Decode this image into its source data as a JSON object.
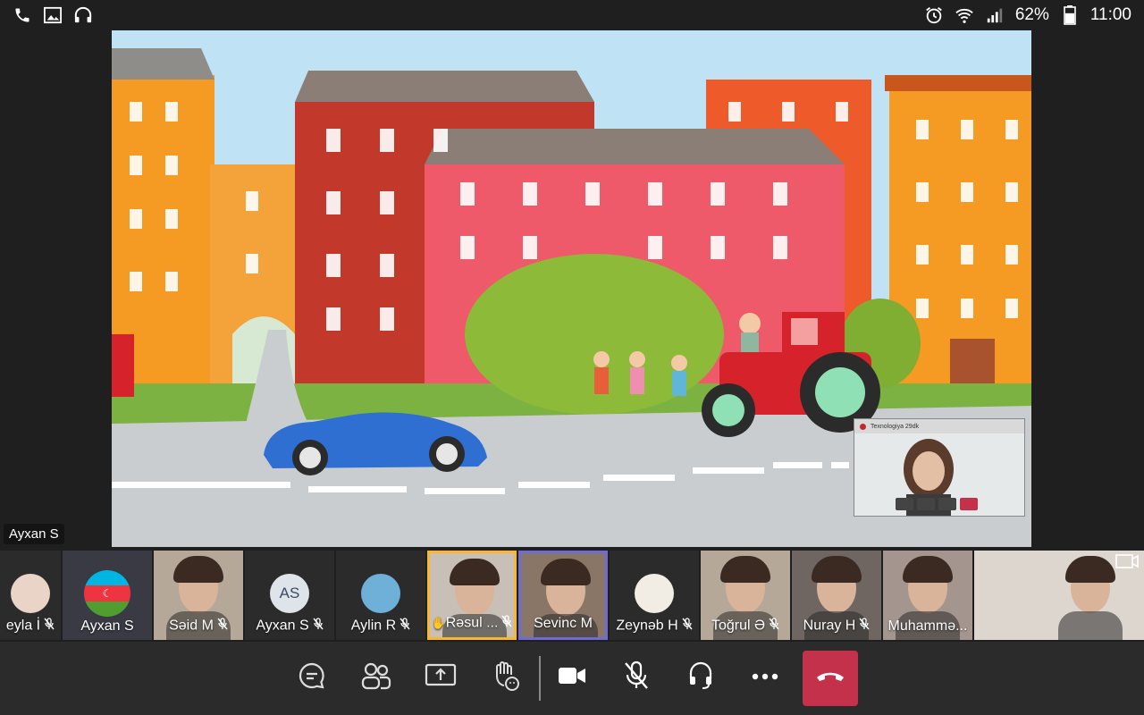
{
  "status_bar": {
    "left_icons": [
      "phone-icon",
      "image-icon",
      "headphones-icon"
    ],
    "right_icons": [
      "alarm-icon",
      "wifi-icon",
      "signal-icon"
    ],
    "battery_percent": "62%",
    "battery_level": 0.62,
    "time": "11:00"
  },
  "shared_screen": {
    "speaker_label": "Ayxan S",
    "pip": {
      "title": "Texnologiya   29dk"
    }
  },
  "participants": [
    {
      "name": "eyla İ",
      "muted": true,
      "kind": "avatar-photo",
      "highlight": ""
    },
    {
      "name": "Ayxan S",
      "muted": false,
      "kind": "flag",
      "highlight": ""
    },
    {
      "name": "Səid M",
      "muted": true,
      "kind": "video",
      "highlight": ""
    },
    {
      "name": "Ayxan S",
      "muted": true,
      "kind": "initials",
      "initials": "AS",
      "highlight": ""
    },
    {
      "name": "Aylin R",
      "muted": true,
      "kind": "avatar-photo",
      "highlight": ""
    },
    {
      "name": "Rəsul ...",
      "muted": true,
      "kind": "video",
      "highlight": "yellow",
      "hand_raised": true
    },
    {
      "name": "Sevinc M",
      "muted": false,
      "kind": "video",
      "highlight": "purple"
    },
    {
      "name": "Zeynəb H",
      "muted": true,
      "kind": "avatar-photo",
      "highlight": ""
    },
    {
      "name": "Toğrul Ə",
      "muted": true,
      "kind": "video",
      "highlight": ""
    },
    {
      "name": "Nuray H",
      "muted": true,
      "kind": "video",
      "highlight": ""
    },
    {
      "name": "Muhammə...",
      "muted": false,
      "kind": "video",
      "highlight": ""
    },
    {
      "name": "",
      "muted": false,
      "kind": "self-video",
      "highlight": ""
    }
  ],
  "controls": {
    "buttons": [
      "chat-icon",
      "participants-icon",
      "share-screen-icon",
      "raise-hand-icon",
      "camera-icon",
      "mic-off-icon",
      "audio-device-icon",
      "more-icon",
      "hang-up-icon"
    ]
  },
  "colors": {
    "end_call": "#c4314b",
    "highlight_speaking": "#f4b73a",
    "highlight_pinned": "#6f6bd0"
  }
}
